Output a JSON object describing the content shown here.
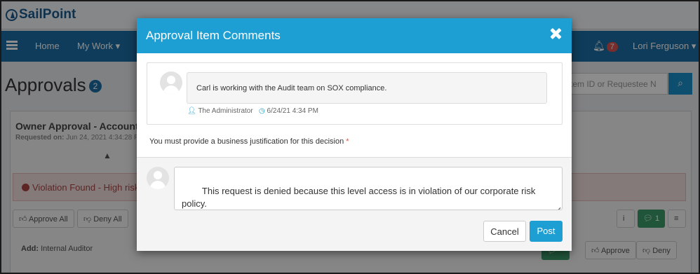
{
  "app": {
    "logo": "SailPoint",
    "nav": {
      "home": "Home",
      "my_work": "My Work",
      "notifications_count": "7",
      "user": "Lori Ferguson"
    },
    "page_title": "Approvals",
    "approvals_count": "2",
    "search_placeholder": "tem ID or Requestee N",
    "card": {
      "title": "Owner Approval - Account C",
      "requested_label": "Requested on:",
      "requested_value": "Jun 24, 2021 4:34:28 P",
      "violation": "Violation Found - High risk",
      "approve_all": "Approve All",
      "deny_all": "Deny All",
      "comment_count": "1",
      "row_label": "Add:",
      "row_value": "Internal Auditor",
      "approve": "Approve",
      "deny": "Deny"
    }
  },
  "modal": {
    "title": "Approval Item Comments",
    "comment": {
      "text": "Carl is working with the Audit team on SOX compliance.",
      "author": "The Administrator",
      "timestamp": "6/24/21 4:34 PM"
    },
    "justification_label": "You must provide a business justification for this decision",
    "required_marker": "*",
    "compose_text": "This request is denied because this level access is in violation of our corporate risk policy.\nPlease contact me to discuss.",
    "cancel_label": "Cancel",
    "post_label": "Post"
  },
  "colors": {
    "modal_header": "#1d9fd3",
    "navbar": "#1c6ea4",
    "post_button": "#1d9fd3",
    "required": "#d9534f"
  },
  "icons": [
    "close-icon",
    "user-icon",
    "clock-icon",
    "avatar-icon",
    "resize-grip-icon",
    "bell-icon",
    "list-icon",
    "search-icon"
  ]
}
